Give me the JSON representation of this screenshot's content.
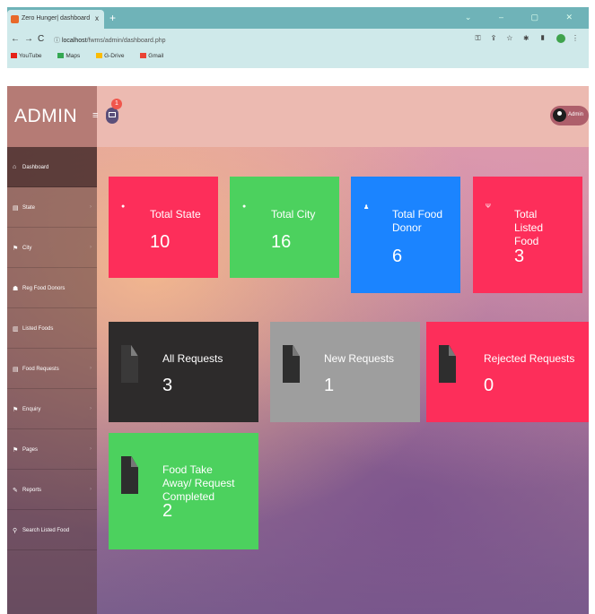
{
  "browser": {
    "tab_title": "Zero Hunger| dashboard",
    "tab_close": "x",
    "new_tab": "+",
    "url_host": "localhost",
    "url_path": "/fwms/admin/dashboard.php",
    "bookmarks": [
      "YouTube",
      "Maps",
      "G-Drive",
      "Gmail"
    ]
  },
  "header": {
    "brand": "ADMIN",
    "mail_badge": "1",
    "user_label": "Admin"
  },
  "sidebar": {
    "items": [
      {
        "label": "Dashboard",
        "icon": "home-icon"
      },
      {
        "label": "State",
        "icon": "file-icon"
      },
      {
        "label": "City",
        "icon": "flag-icon"
      },
      {
        "label": "Reg Food Donors",
        "icon": "users-icon"
      },
      {
        "label": "Listed Foods",
        "icon": "list-icon"
      },
      {
        "label": "Food Requests",
        "icon": "file-icon"
      },
      {
        "label": "Enquiry",
        "icon": "flag-icon"
      },
      {
        "label": "Pages",
        "icon": "flag-icon"
      },
      {
        "label": "Reports",
        "icon": "report-icon"
      },
      {
        "label": "Search Listed Food",
        "icon": "search-icon"
      }
    ]
  },
  "stats": [
    {
      "title": "Total State",
      "value": "10",
      "color": "#fd2e5a"
    },
    {
      "title": "Total City",
      "value": "16",
      "color": "#4cd15e"
    },
    {
      "title": "Total Food Donor",
      "value": "6",
      "color": "#1b84ff"
    },
    {
      "title": "Total Listed Food",
      "value": "3",
      "color": "#fd2e5a"
    }
  ],
  "requests": [
    {
      "title": "All Requests",
      "value": "3",
      "color": "#2d2b2b"
    },
    {
      "title": "New Requests",
      "value": "1",
      "color": "#9e9e9e"
    },
    {
      "title": "Rejected Requests",
      "value": "0",
      "color": "#fd2e5a"
    },
    {
      "title": "Food Take Away/ Request Completed",
      "value": "2",
      "color": "#4cd15e"
    }
  ]
}
